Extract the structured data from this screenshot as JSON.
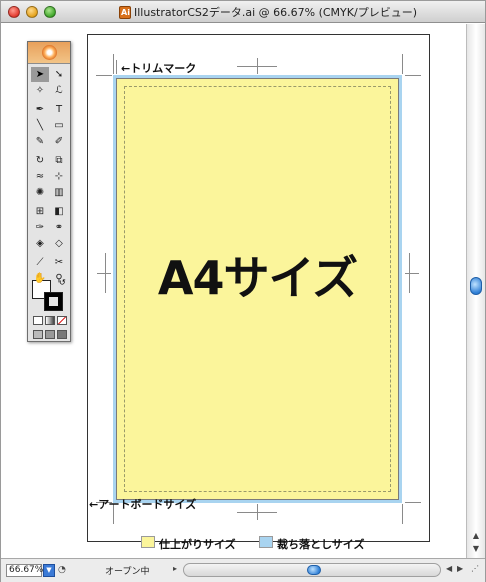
{
  "window": {
    "title": "IllustratorCS2データ.ai @ 66.67% (CMYK/プレビュー)",
    "doc_icon_label": "Ai"
  },
  "document": {
    "big_label": "A4サイズ",
    "trim_mark_label": "←トリムマーク",
    "artboard_label": "←アートボードサイズ"
  },
  "legend": [
    {
      "label": "仕上がりサイズ",
      "color": "#fbf59b"
    },
    {
      "label": "裁ち落としサイズ",
      "color": "#a9d4f0"
    }
  ],
  "statusbar": {
    "zoom": "66.67%",
    "status": "オープン中"
  },
  "tools": [
    {
      "name": "selection-tool",
      "glyph": "➤"
    },
    {
      "name": "direct-selection-tool",
      "glyph": "➘"
    },
    {
      "name": "magic-wand-tool",
      "glyph": "✧"
    },
    {
      "name": "lasso-tool",
      "glyph": "ℒ"
    },
    {
      "name": "pen-tool",
      "glyph": "✒"
    },
    {
      "name": "type-tool",
      "glyph": "T"
    },
    {
      "name": "line-tool",
      "glyph": "╲"
    },
    {
      "name": "rectangle-tool",
      "glyph": "▭"
    },
    {
      "name": "paintbrush-tool",
      "glyph": "✎"
    },
    {
      "name": "pencil-tool",
      "glyph": "✐"
    },
    {
      "name": "rotate-tool",
      "glyph": "↻"
    },
    {
      "name": "scale-tool",
      "glyph": "⧉"
    },
    {
      "name": "warp-tool",
      "glyph": "≈"
    },
    {
      "name": "free-transform-tool",
      "glyph": "⊹"
    },
    {
      "name": "symbol-sprayer-tool",
      "glyph": "✺"
    },
    {
      "name": "graph-tool",
      "glyph": "▥"
    },
    {
      "name": "mesh-tool",
      "glyph": "⊞"
    },
    {
      "name": "gradient-tool",
      "glyph": "◧"
    },
    {
      "name": "eyedropper-tool",
      "glyph": "✑"
    },
    {
      "name": "blend-tool",
      "glyph": "⚭"
    },
    {
      "name": "live-paint-tool",
      "glyph": "◈"
    },
    {
      "name": "live-paint-selection-tool",
      "glyph": "◇"
    },
    {
      "name": "slice-tool",
      "glyph": "⟋"
    },
    {
      "name": "scissors-tool",
      "glyph": "✂"
    },
    {
      "name": "hand-tool",
      "glyph": "✋"
    },
    {
      "name": "zoom-tool",
      "glyph": "⚲"
    }
  ],
  "colors": {
    "trim_fill": "#fbf59b",
    "bleed_fill": "#a9d4f0",
    "accent_blue": "#2f7fd6"
  }
}
